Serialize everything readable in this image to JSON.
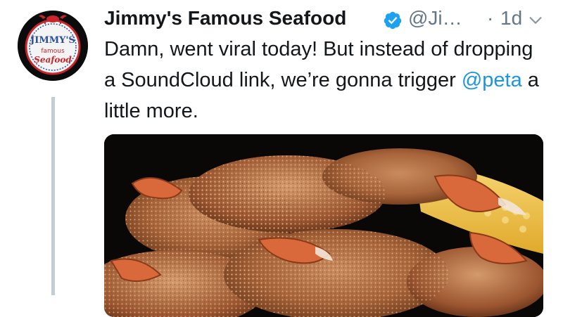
{
  "tweet": {
    "author_name": "Jimmy's Famous Seafood",
    "handle": "@Ji…",
    "separator": "·",
    "time": "1d",
    "text_part1": "Damn, went viral today! But instead of dropping a SoundCloud link, we’re gonna trigger ",
    "mention": "@peta",
    "text_part2": " a little more."
  },
  "avatar": {
    "logo_line1": "JIMMY'S",
    "logo_line2": "famous",
    "logo_line3": "Seafood"
  },
  "icons": {
    "verified": "verified-badge-icon",
    "menu": "chevron-down-icon"
  },
  "colors": {
    "link": "#1b95e0",
    "verified": "#1da1f2",
    "secondary_text": "#657786",
    "thread_line": "#c4cdd5"
  },
  "media": {
    "description_icon": "photo-crabs-and-corn"
  }
}
